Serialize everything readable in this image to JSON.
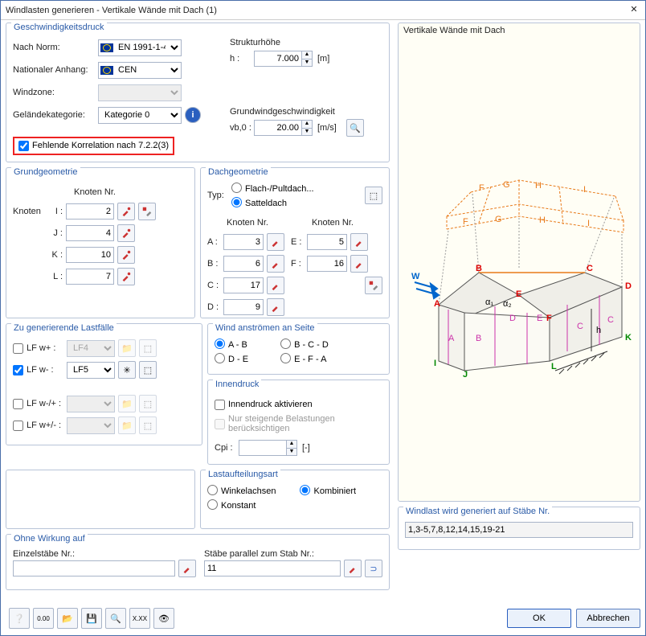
{
  "window": {
    "title": "Windlasten generieren  -  Vertikale Wände mit Dach   (1)"
  },
  "speed": {
    "title": "Geschwindigkeitsdruck",
    "norm_lbl": "Nach Norm:",
    "norm_val": "EN 1991-1-4",
    "annex_lbl": "Nationaler Anhang:",
    "annex_val": "CEN",
    "zone_lbl": "Windzone:",
    "terrain_lbl": "Geländekategorie:",
    "terrain_val": "Kategorie 0",
    "corr_lbl": "Fehlende Korrelation nach 7.2.2(3)",
    "h_title": "Strukturhöhe",
    "h_lbl": "h :",
    "h_val": "7.000",
    "h_unit": "[m]",
    "vb_title": "Grundwindgeschwindigkeit",
    "vb_lbl": "vb,0 :",
    "vb_val": "20.00",
    "vb_unit": "[m/s]"
  },
  "geo": {
    "title": "Grundgeometrie",
    "knoten_hdr": "Knoten Nr.",
    "knoten_lbl": "Knoten",
    "I_lbl": "I :",
    "I": "2",
    "J_lbl": "J :",
    "J": "4",
    "K_lbl": "K :",
    "K": "10",
    "L_lbl": "L :",
    "L": "7"
  },
  "roof": {
    "title": "Dachgeometrie",
    "typ_lbl": "Typ:",
    "flat": "Flach-/Pultdach...",
    "gable": "Satteldach",
    "knoten_hdr": "Knoten Nr.",
    "knoten_hdr2": "Knoten Nr.",
    "A_lbl": "A :",
    "A": "3",
    "B_lbl": "B :",
    "B": "6",
    "C_lbl": "C :",
    "C": "17",
    "D_lbl": "D :",
    "D": "9",
    "E_lbl": "E :",
    "E": "5",
    "F_lbl": "F :",
    "F": "16"
  },
  "lc": {
    "title": "Zu generierende Lastfälle",
    "wp_lbl": "LF w+ :",
    "wp_val": "LF4",
    "wm_lbl": "LF w- :",
    "wm_val": "LF5",
    "wmp_lbl": "LF w-/+ :",
    "wpm_lbl": "LF w+/- :"
  },
  "wind": {
    "title": "Wind anströmen an Seite",
    "ab": "A - B",
    "bcd": "B - C - D",
    "de": "D - E",
    "efa": "E - F - A"
  },
  "inner": {
    "title": "Innendruck",
    "chk": "Innendruck aktivieren",
    "chk2": "Nur steigende Belastungen berücksichtigen",
    "cpi_lbl": "Cpi :",
    "cpi_unit": "[-]"
  },
  "dist": {
    "title": "Lastaufteilungsart",
    "winkel": "Winkelachsen",
    "komb": "Kombiniert",
    "konst": "Konstant"
  },
  "excl": {
    "title": "Ohne Wirkung auf",
    "single_lbl": "Einzelstäbe Nr.:",
    "parallel_lbl": "Stäbe parallel zum Stab Nr.:",
    "parallel_val": "11"
  },
  "preview": {
    "title": "Vertikale Wände mit Dach"
  },
  "gen": {
    "title": "Windlast wird generiert auf Stäbe Nr.",
    "val": "1,3-5,7,8,12,14,15,19-21"
  },
  "footer": {
    "ok": "OK",
    "cancel": "Abbrechen"
  }
}
